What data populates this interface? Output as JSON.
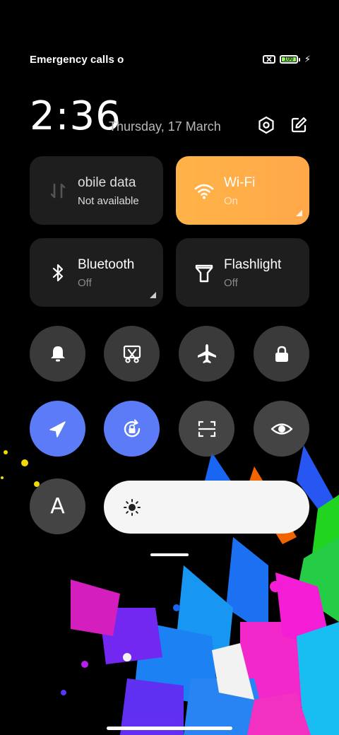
{
  "status_bar": {
    "carrier": "Emergency calls o",
    "battery_level": "100",
    "battery_fraction": 1.0,
    "battery_color": "#8aff4f",
    "icons": [
      "no-sim-icon",
      "battery-icon",
      "charging-bolt-icon"
    ]
  },
  "header": {
    "time": "2:36",
    "date": "Thursday, 17 March",
    "settings_icon": "settings-hexagon-icon",
    "edit_icon": "edit-icon"
  },
  "tiles": {
    "mobile_data": {
      "title": "obile data",
      "status": "Not available",
      "icon": "mobile-data-icon"
    },
    "wifi": {
      "title": "Wi-Fi",
      "status": "On",
      "icon": "wifi-icon",
      "color": "#ffa84a"
    },
    "bluetooth": {
      "title": "Bluetooth",
      "status": "Off",
      "icon": "bluetooth-icon"
    },
    "flashlight": {
      "title": "Flashlight",
      "status": "Off",
      "icon": "flashlight-icon"
    }
  },
  "toggles_row1": [
    "bell-icon",
    "screenshot-crop-icon",
    "airplane-icon",
    "lock-icon"
  ],
  "toggles_row2": [
    {
      "icon": "location-icon",
      "active": true
    },
    {
      "icon": "auto-rotate-icon",
      "active": true
    },
    {
      "icon": "scan-icon",
      "active": false
    },
    {
      "icon": "eye-icon",
      "active": false
    }
  ],
  "auto_brightness": {
    "label": "A"
  },
  "brightness": {
    "level": 0.0,
    "icon": "sun-icon",
    "accent": "#5b7cf6"
  }
}
